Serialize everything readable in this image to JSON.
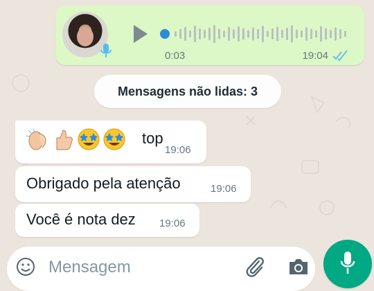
{
  "voice_message": {
    "duration": "0:03",
    "time": "19:04",
    "status": "read",
    "icons": [
      "avatar",
      "microphone",
      "play",
      "double-check"
    ]
  },
  "unread_banner": "Mensagens não lidas: 3",
  "messages": [
    {
      "text": "👏👍🤩🤩top",
      "time": "19:06"
    },
    {
      "text": "Obrigado pela atenção",
      "time": "19:06"
    },
    {
      "text": "Você é nota dez",
      "time": "19:06"
    }
  ],
  "composer": {
    "placeholder": "Mensagem",
    "icons": [
      "emoji",
      "paperclip",
      "camera",
      "microphone"
    ]
  },
  "colors": {
    "background": "#ece5dd",
    "outgoing_bubble": "#dcf8c6",
    "incoming_bubble": "#ffffff",
    "accent": "#00a884",
    "read_ticks": "#53bdeb"
  }
}
